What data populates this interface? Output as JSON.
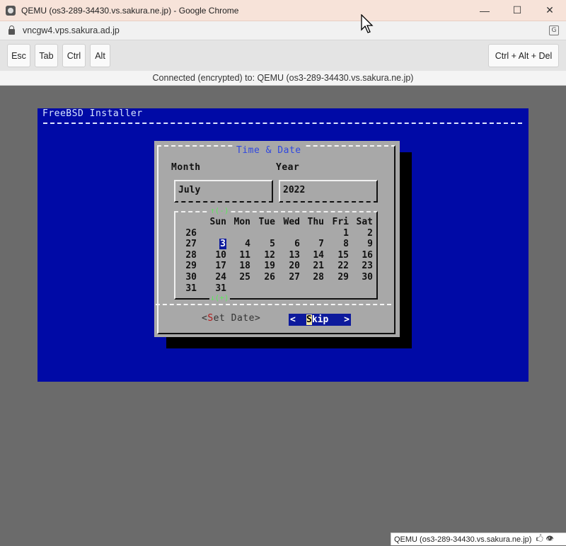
{
  "window": {
    "title": "QEMU (os3-289-34430.vs.sakura.ne.jp) - Google Chrome",
    "minimize_glyph": "—",
    "maximize_glyph": "☐",
    "close_glyph": "✕"
  },
  "address": {
    "url": "vncgw4.vps.sakura.ad.jp",
    "translate_glyph": "G"
  },
  "toolbar": {
    "esc": "Esc",
    "tab": "Tab",
    "ctrl": "Ctrl",
    "alt": "Alt",
    "ctrl_alt_del": "Ctrl + Alt + Del"
  },
  "status": {
    "text": "Connected (encrypted) to: QEMU (os3-289-34430.vs.sakura.ne.jp)"
  },
  "installer": {
    "title": "FreeBSD Installer",
    "dialog": {
      "title": "Time & Date",
      "month_label": "Month",
      "year_label": "Year",
      "month_value": "July",
      "year_value": "2022",
      "scroll_up": "↑(-)",
      "scroll_down": "↓(+)",
      "set_date_open": "<",
      "set_date_hot": "S",
      "set_date_rest": "et Date>",
      "skip_open": "<",
      "skip_hot": "S",
      "skip_rest": "kip",
      "skip_close": ">"
    },
    "calendar": {
      "headers": [
        "Sun",
        "Mon",
        "Tue",
        "Wed",
        "Thu",
        "Fri",
        "Sat"
      ],
      "weeks": [
        {
          "week": "26",
          "days": [
            "",
            "",
            "",
            "",
            "",
            "1",
            "2"
          ]
        },
        {
          "week": "27",
          "days": [
            "3",
            "4",
            "5",
            "6",
            "7",
            "8",
            "9"
          ]
        },
        {
          "week": "28",
          "days": [
            "10",
            "11",
            "12",
            "13",
            "14",
            "15",
            "16"
          ]
        },
        {
          "week": "29",
          "days": [
            "17",
            "18",
            "19",
            "20",
            "21",
            "22",
            "23"
          ]
        },
        {
          "week": "30",
          "days": [
            "24",
            "25",
            "26",
            "27",
            "28",
            "29",
            "30"
          ]
        },
        {
          "week": "31",
          "days": [
            "31",
            "",
            "",
            "",
            "",
            "",
            ""
          ]
        }
      ],
      "selected_day": "3"
    }
  },
  "footer": {
    "label": "QEMU (os3-289-34430.vs.sakura.ne.jp)",
    "icons": "🖒 👁"
  }
}
